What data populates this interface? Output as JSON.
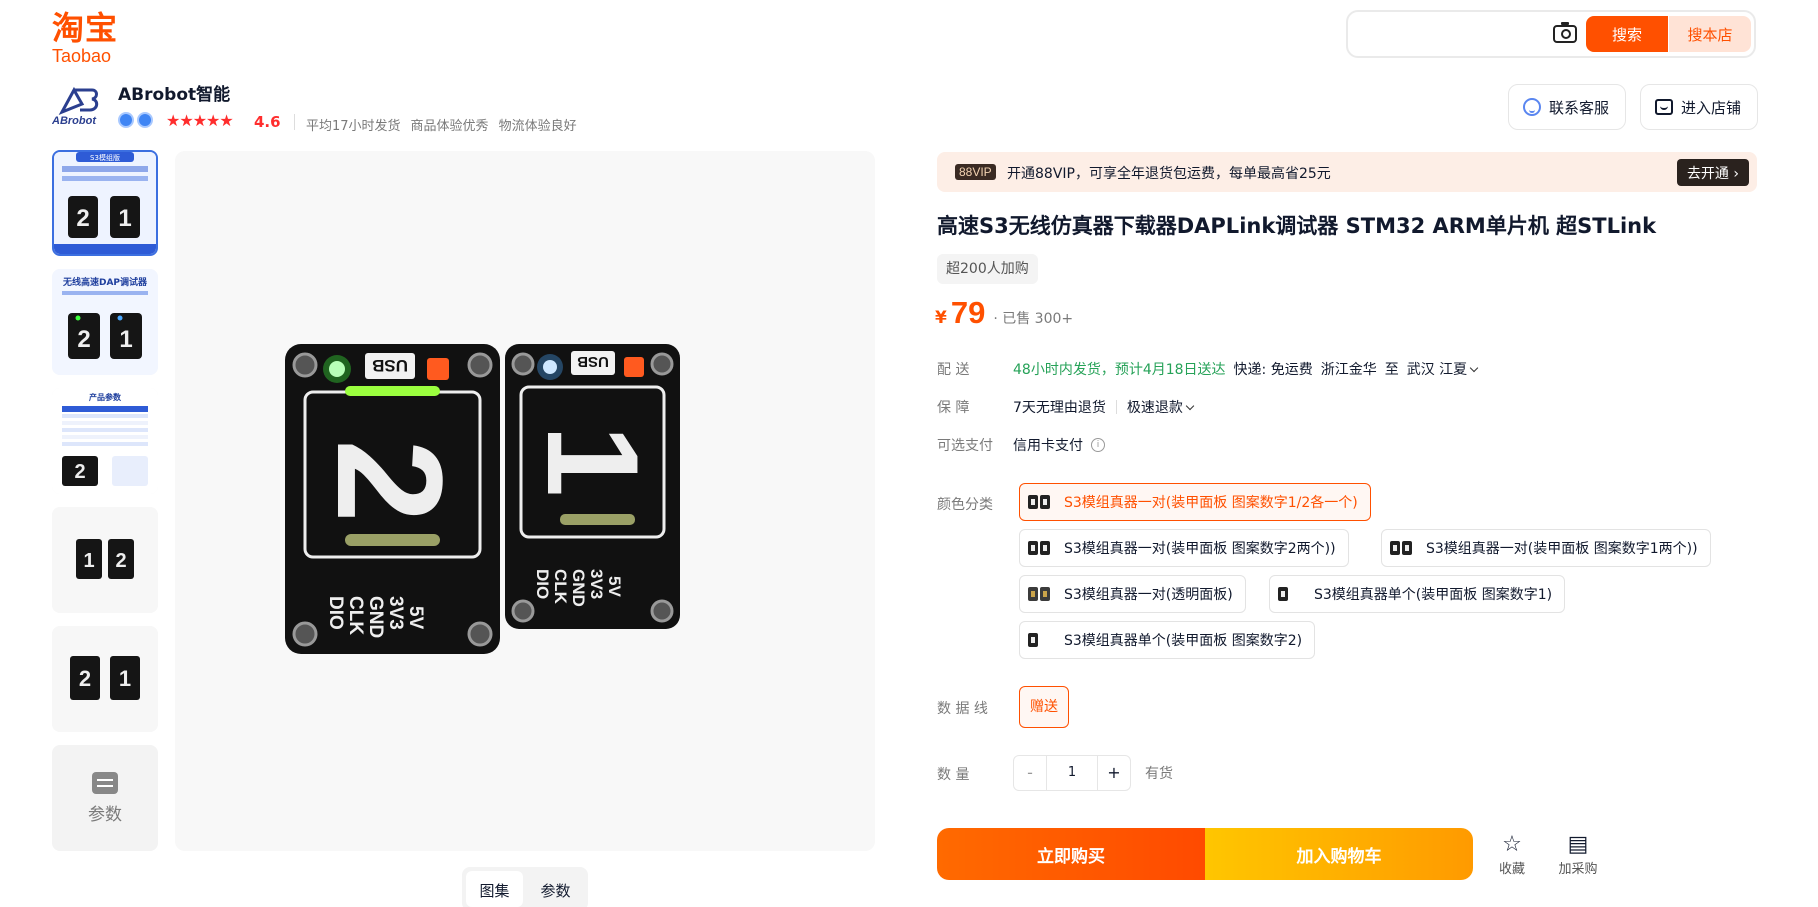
{
  "logo": {
    "cn": "淘宝",
    "en": "Taobao"
  },
  "search": {
    "value": "",
    "placeholder": "",
    "search_label": "搜索",
    "shop_label": "搜本店"
  },
  "shop": {
    "name": "ABrobot智能",
    "logo_text": "ABrobot",
    "stars": "★★★★★",
    "rating": "4.6",
    "stats": [
      "平均17小时发货",
      "商品体验优秀",
      "物流体验良好"
    ],
    "service_label": "联系客服",
    "store_label": "进入店铺"
  },
  "gallery": {
    "thumbs": [
      "S3模组版",
      "无线高速DAP调试器",
      "产品参数",
      "",
      ""
    ],
    "params_label": "参数",
    "tabs": [
      "图集",
      "参数"
    ],
    "active_tab": "图集",
    "image": {
      "left_board": {
        "label": "USB",
        "digit": "2",
        "pins": [
          "5V",
          "3V3",
          "GND",
          "CLK",
          "DIO"
        ],
        "led": "#3dff3d"
      },
      "right_board": {
        "label": "USB",
        "digit": "1",
        "pins": [
          "5V",
          "3V3",
          "GND",
          "CLK",
          "DIO"
        ],
        "led": "#4aa8ff"
      }
    }
  },
  "vip": {
    "tag": "88VIP",
    "text": "开通88VIP，可享全年退货包运费，每单最高省25元",
    "button": "去开通 ›"
  },
  "product": {
    "title": "高速S3无线仿真器下载器DAPLink调试器 STM32 ARM单片机 超STLink",
    "sold_tag": "超200人加购",
    "currency": "¥",
    "price": "79",
    "sold": "· 已售 300+"
  },
  "delivery": {
    "label": "配    送",
    "time": "48小时内发货，预计4月18日送达",
    "fee": "快递: 免运费",
    "from": "浙江金华",
    "to_word": "至",
    "to": "武汉 江夏"
  },
  "guarantee": {
    "label": "保    障",
    "items": [
      "7天无理由退货",
      "极速退款"
    ]
  },
  "payment": {
    "label": "可选支付",
    "value": "信用卡支付",
    "info": "i"
  },
  "color": {
    "label": "颜色分类",
    "selected": 0,
    "options": [
      "S3模组真器一对(装甲面板 图案数字1/2各一个)",
      "S3模组真器一对(装甲面板 图案数字2两个))",
      "S3模组真器一对(装甲面板 图案数字1两个))",
      "S3模组真器一对(透明面板)",
      "S3模组真器单个(装甲面板 图案数字1)",
      "S3模组真器单个(装甲面板 图案数字2)"
    ]
  },
  "cable": {
    "label": "数 据 线",
    "value": "赠送"
  },
  "quantity": {
    "label": "数    量",
    "minus": "-",
    "value": "1",
    "plus": "+",
    "stock": "有货"
  },
  "actions": {
    "buy": "立即购买",
    "cart": "加入购物车",
    "fav": "收藏",
    "fav_icon": "☆",
    "purchase": "加采购",
    "purchase_icon": "▤"
  },
  "colors": {
    "accent": "#ff5000",
    "green": "#26a258",
    "rating": "#ff2d2d"
  }
}
